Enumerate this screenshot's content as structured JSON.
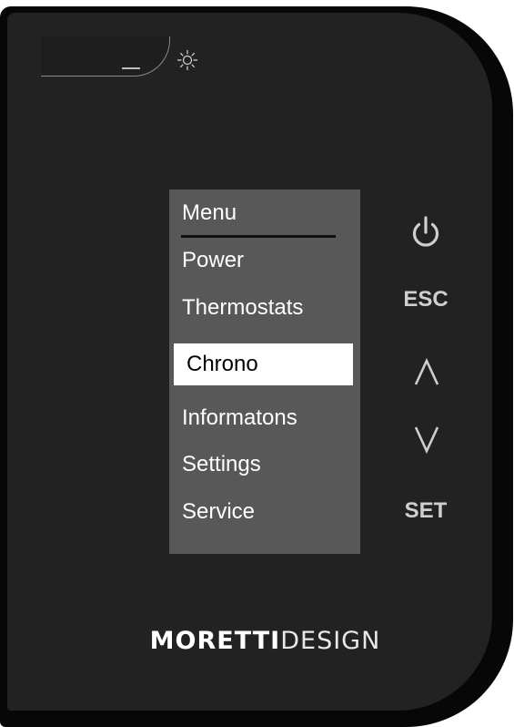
{
  "menu": {
    "title": "Menu",
    "items": [
      {
        "label": "Power",
        "selected": false
      },
      {
        "label": "Thermostats",
        "selected": false
      },
      {
        "label": "Chrono",
        "selected": true
      },
      {
        "label": "Informatons",
        "selected": false
      },
      {
        "label": "Settings",
        "selected": false
      },
      {
        "label": "Service",
        "selected": false
      }
    ]
  },
  "buttons": {
    "power_icon": "power-icon",
    "esc_label": "ESC",
    "up_icon": "up-arrow-icon",
    "down_icon": "down-arrow-icon",
    "set_label": "SET"
  },
  "brand": {
    "bold": "MORETTI",
    "light": "DESIGN"
  },
  "indicators": {
    "light_sensor_icon": "sun-icon"
  },
  "colors": {
    "device_bezel": "#070707",
    "device_face": "#222222",
    "screen_bg": "#585858",
    "selected_bg": "#ffffff",
    "button_text": "#cfcfcf"
  }
}
